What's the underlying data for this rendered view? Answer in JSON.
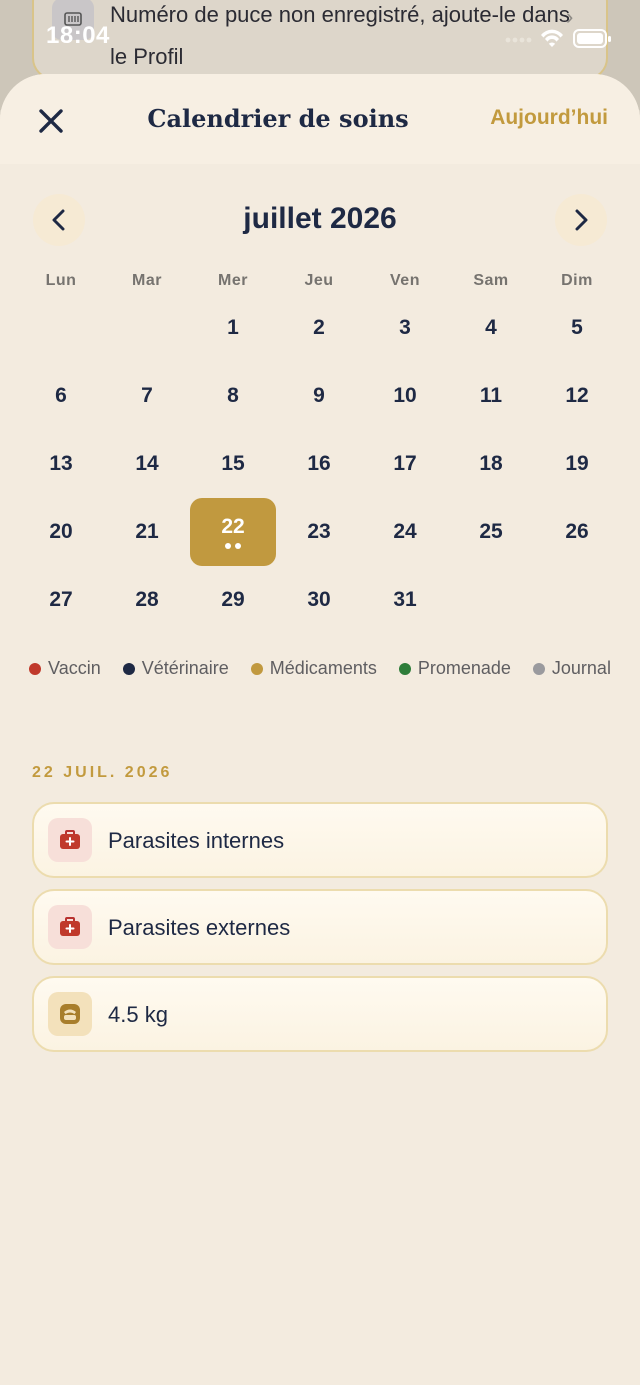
{
  "status_bar": {
    "time": "18:04"
  },
  "background_card": {
    "text": "Numéro de puce non enregistré, ajoute-le dans le Profil"
  },
  "header": {
    "title": "Calendrier de soins",
    "today_button": "Aujourd’hui"
  },
  "calendar": {
    "month_label": "juillet 2026",
    "weekdays": [
      "Lun",
      "Mar",
      "Mer",
      "Jeu",
      "Ven",
      "Sam",
      "Dim"
    ],
    "leading_blanks": 2,
    "days": [
      "1",
      "2",
      "3",
      "4",
      "5",
      "6",
      "7",
      "8",
      "9",
      "10",
      "11",
      "12",
      "13",
      "14",
      "15",
      "16",
      "17",
      "18",
      "19",
      "20",
      "21",
      "22",
      "23",
      "24",
      "25",
      "26",
      "27",
      "28",
      "29",
      "30",
      "31"
    ],
    "selected_day": "22",
    "selected_day_event_dots": 2
  },
  "legend": [
    {
      "label": "Vaccin",
      "color": "#c0392b"
    },
    {
      "label": "Vétérinaire",
      "color": "#1e2944"
    },
    {
      "label": "Médicaments",
      "color": "#c1993f"
    },
    {
      "label": "Promenade",
      "color": "#2e7d3a"
    },
    {
      "label": "Journal",
      "color": "#9a9a9e"
    }
  ],
  "selected_section": {
    "date_label": "22 JUIL. 2026",
    "events": [
      {
        "label": "Parasites internes",
        "icon": "medical-kit-icon",
        "kind": "med"
      },
      {
        "label": "Parasites externes",
        "icon": "medical-kit-icon",
        "kind": "med"
      },
      {
        "label": "4.5 kg",
        "icon": "scale-icon",
        "kind": "weight"
      }
    ]
  },
  "colors": {
    "accent": "#c1993f",
    "ink": "#1e2944",
    "sheet": "#f3ebdf"
  }
}
